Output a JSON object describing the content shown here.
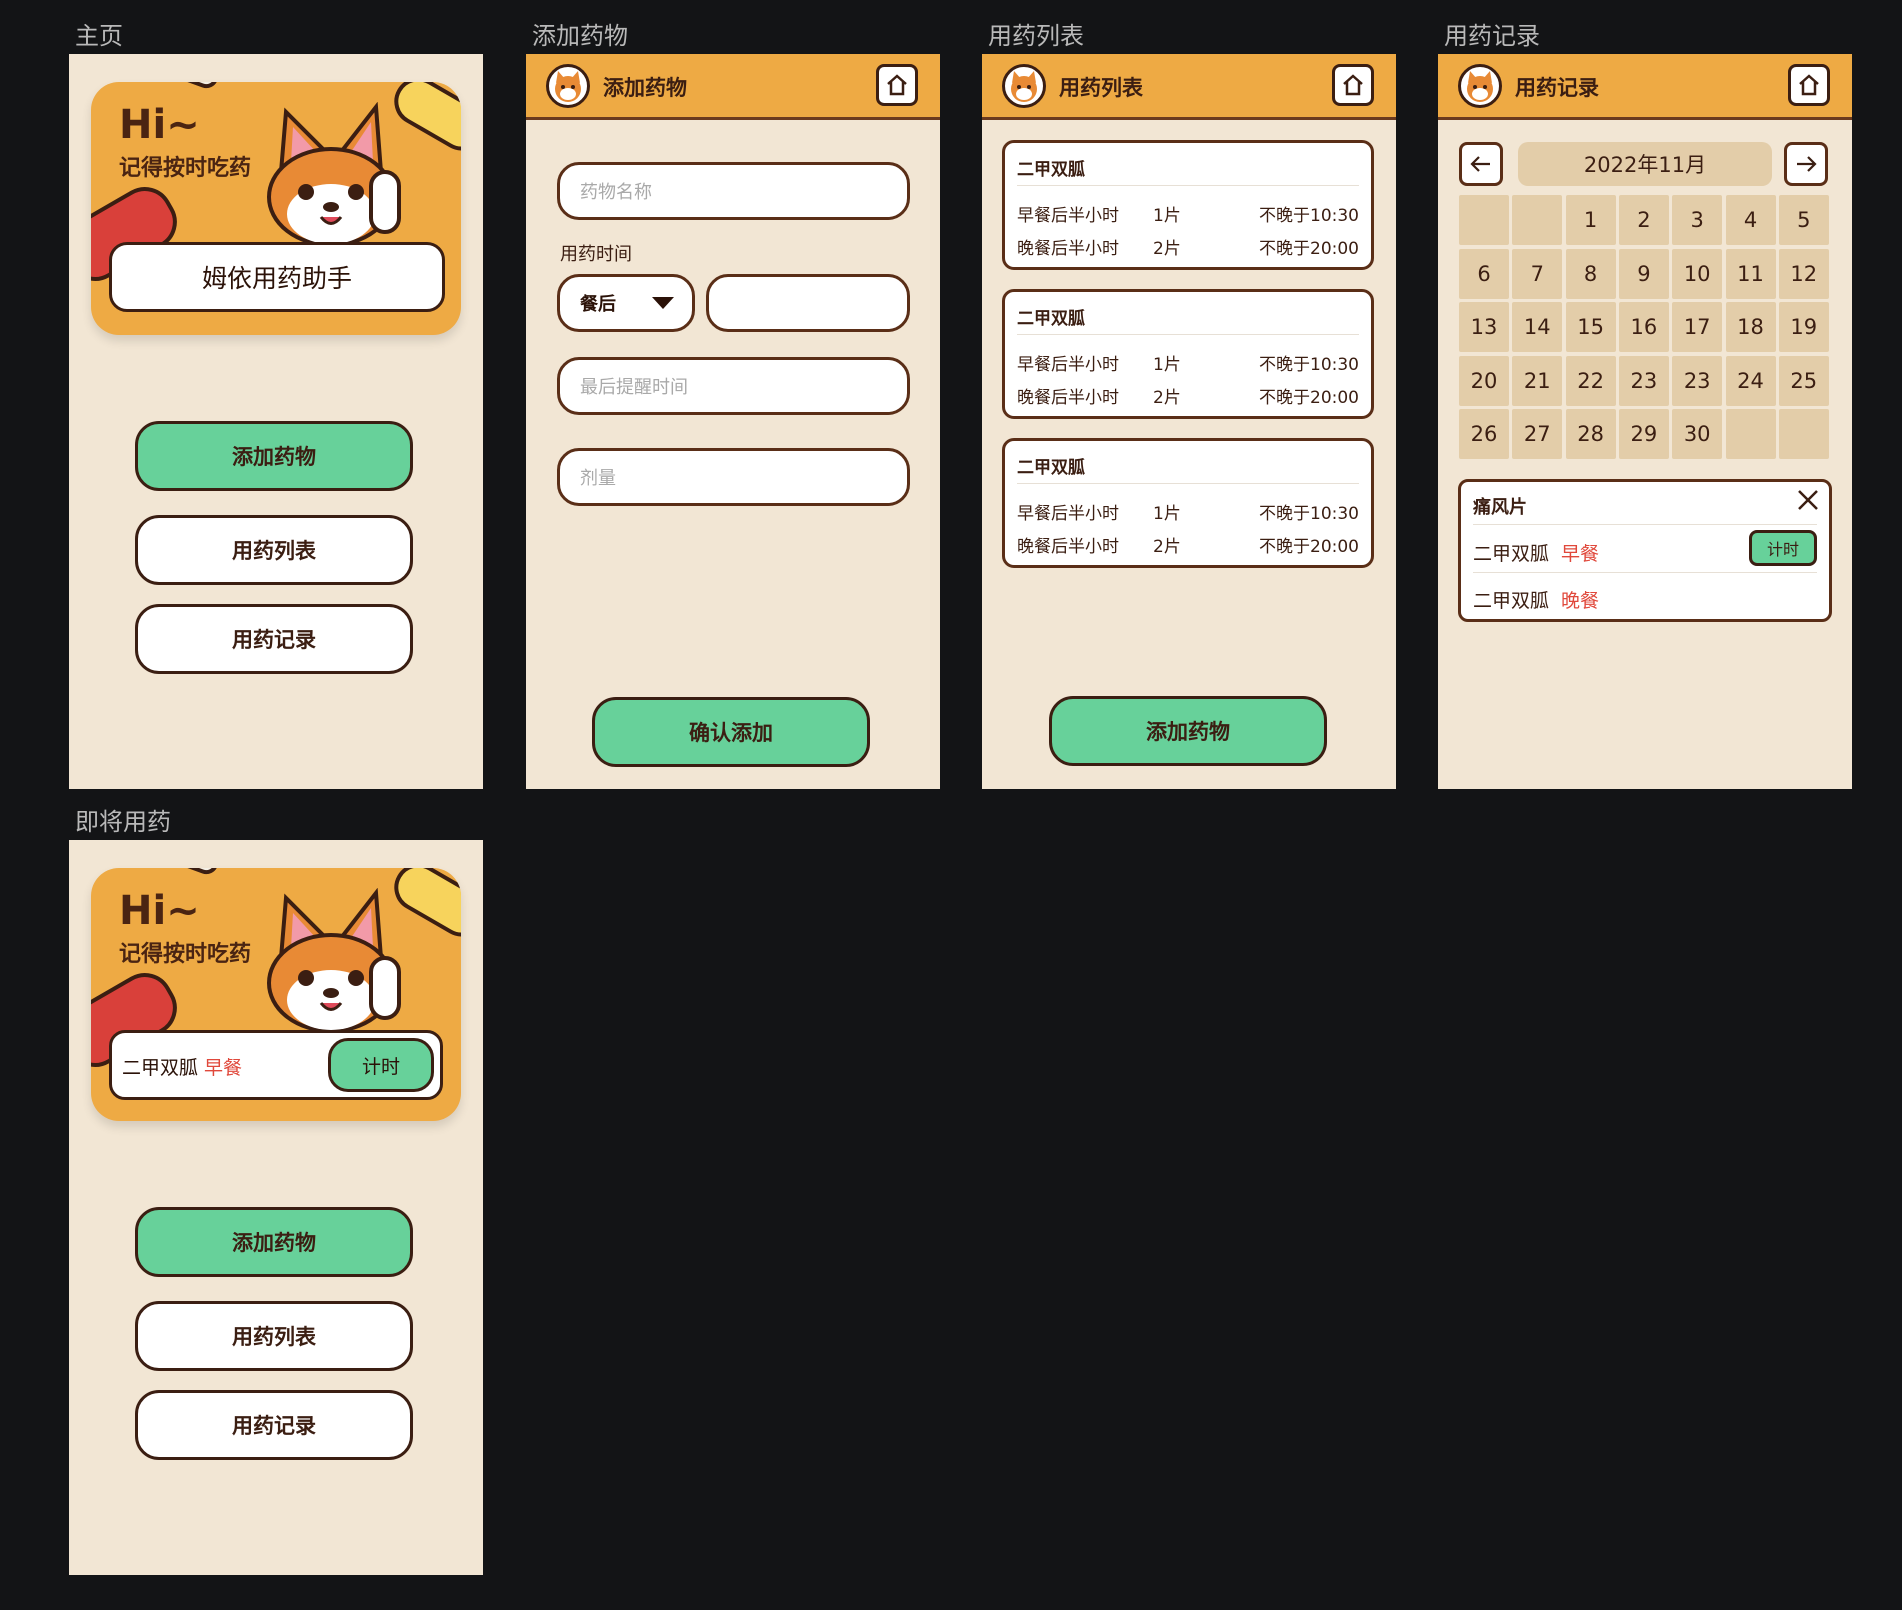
{
  "frames": {
    "home": "主页",
    "add": "添加药物",
    "list": "用药列表",
    "records": "用药记录",
    "upcoming": "即将用药"
  },
  "banner": {
    "hi": "Hi~",
    "subtitle": "记得按时吃药",
    "brand": "姆依用药助手"
  },
  "home_buttons": {
    "add": "添加药物",
    "list": "用药列表",
    "records": "用药记录"
  },
  "add_screen": {
    "title": "添加药物",
    "name_placeholder": "药物名称",
    "time_label": "用药时间",
    "meal_select": "餐后",
    "last_reminder_placeholder": "最后提醒时间",
    "dose_placeholder": "剂量",
    "confirm": "确认添加"
  },
  "list_screen": {
    "title": "用药列表",
    "cards": [
      {
        "name": "二甲双胍",
        "rows": [
          {
            "time": "早餐后半小时",
            "dose": "1片",
            "limit": "不晚于10:30"
          },
          {
            "time": "晚餐后半小时",
            "dose": "2片",
            "limit": "不晚于20:00"
          }
        ]
      },
      {
        "name": "二甲双胍",
        "rows": [
          {
            "time": "早餐后半小时",
            "dose": "1片",
            "limit": "不晚于10:30"
          },
          {
            "time": "晚餐后半小时",
            "dose": "2片",
            "limit": "不晚于20:00"
          }
        ]
      },
      {
        "name": "二甲双胍",
        "rows": [
          {
            "time": "早餐后半小时",
            "dose": "1片",
            "limit": "不晚于10:30"
          },
          {
            "time": "晚餐后半小时",
            "dose": "2片",
            "limit": "不晚于20:00"
          }
        ]
      }
    ],
    "add": "添加药物"
  },
  "records_screen": {
    "title": "用药记录",
    "month": "2022年11月",
    "prev_icon": "arrow-left-icon",
    "next_icon": "arrow-right-icon",
    "days": [
      "",
      "",
      "1",
      "2",
      "3",
      "4",
      "5",
      "6",
      "7",
      "8",
      "9",
      "10",
      "11",
      "12",
      "13",
      "14",
      "15",
      "16",
      "17",
      "18",
      "19",
      "20",
      "21",
      "22",
      "23",
      "23",
      "24",
      "25",
      "26",
      "27",
      "28",
      "29",
      "30",
      "",
      ""
    ],
    "selected_day": "11",
    "popup": {
      "title": "痛风片",
      "rows": [
        {
          "name": "二甲双胍",
          "meal": "早餐",
          "action": "计时"
        },
        {
          "name": "二甲双胍",
          "meal": "晚餐"
        }
      ]
    }
  },
  "upcoming_screen": {
    "med_name": "二甲双胍",
    "meal": "早餐",
    "timer": "计时"
  },
  "colors": {
    "background": "#131416",
    "screen_bg": "#f2e6d4",
    "header": "#eeaa44",
    "green": "#67d19a",
    "brown": "#3b1e12",
    "red": "#e0483b"
  }
}
